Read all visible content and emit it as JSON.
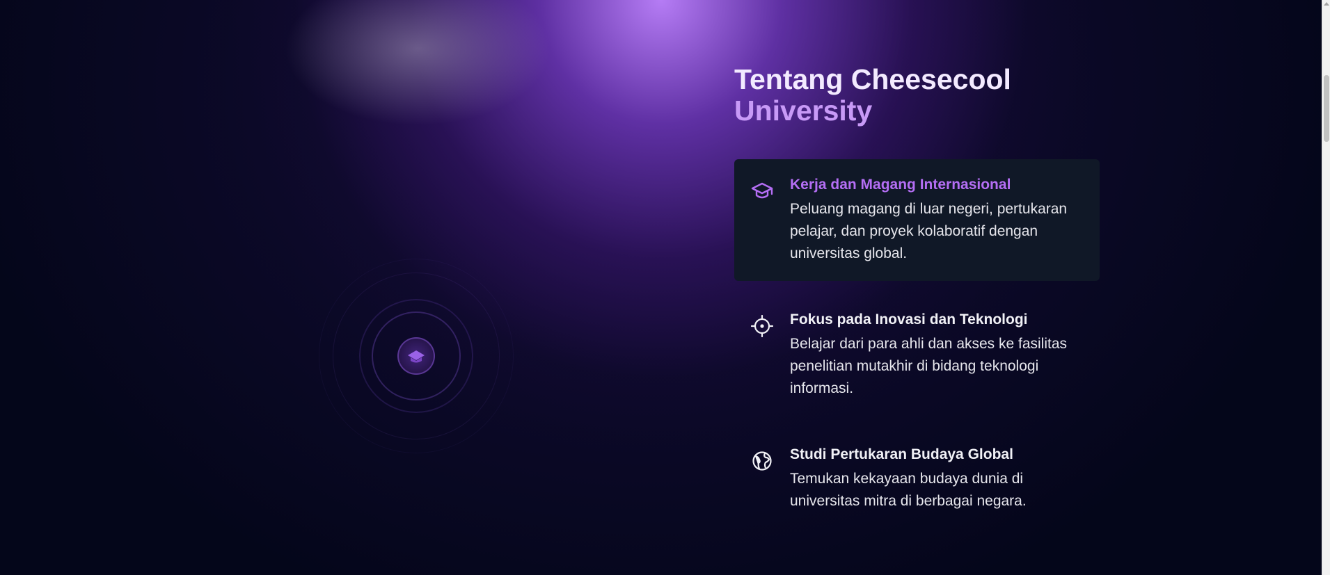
{
  "heading": {
    "line1": "Tentang Cheesecool",
    "line2": "University"
  },
  "features": [
    {
      "icon": "graduation-cap-icon",
      "title": "Kerja dan Magang Internasional",
      "desc": "Peluang magang di luar negeri, pertukaran pelajar, dan proyek kolaboratif dengan universitas global.",
      "active": true
    },
    {
      "icon": "crosshair-icon",
      "title": "Fokus pada Inovasi dan Teknologi",
      "desc": "Belajar dari para ahli dan akses ke fasilitas penelitian mutakhir di bidang teknologi informasi.",
      "active": false
    },
    {
      "icon": "globe-icon",
      "title": "Studi Pertukaran Budaya Global",
      "desc": "Temukan kekayaan budaya dunia di universitas mitra di berbagai negara.",
      "active": false
    }
  ],
  "logo": {
    "icon": "university-logo-icon"
  },
  "colors": {
    "background": "#04061a",
    "accent": "#b46ef4",
    "heading_accent": "#c89af7",
    "card": "#101827",
    "text": "#e6e6ec"
  }
}
